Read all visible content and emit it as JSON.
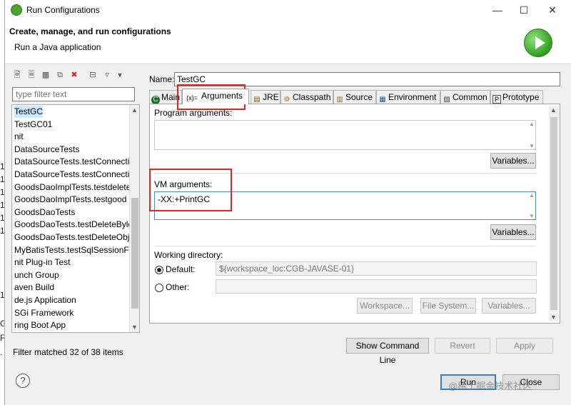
{
  "window": {
    "title": "Run Configurations",
    "banner_title": "Create, manage, and run configurations",
    "banner_subtitle": "Run a Java application"
  },
  "left": {
    "filter_placeholder": "type filter text",
    "items": [
      "TestGC",
      "TestGC01",
      "nit",
      "DataSourceTests",
      "DataSourceTests.testConnectic",
      "DataSourceTests.testConnectic",
      "GoodsDaoImplTests.testdelete",
      "GoodsDaoImplTests.testgood",
      "GoodsDaoTests",
      "GoodsDaoTests.testDeleteBylc",
      "GoodsDaoTests.testDeleteObj",
      "MyBatisTests.testSqlSessionFa",
      "nit Plug-in Test",
      "unch Group",
      "aven Build",
      "de.js Application",
      "SGi Framework",
      "ring Boot App"
    ],
    "cut_chars": [
      "1",
      "1",
      "1",
      "1",
      "1",
      "1",
      "1",
      "G",
      "F",
      "."
    ],
    "status": "Filter matched 32 of 38 items"
  },
  "right": {
    "name_label": "Name:",
    "name_value": "TestGC",
    "tabs": [
      {
        "label": "Main",
        "icon": "C"
      },
      {
        "label": "Arguments",
        "icon": "(x)="
      },
      {
        "label": "JRE",
        "icon": "▤"
      },
      {
        "label": "Classpath",
        "icon": "⚙"
      },
      {
        "label": "Source",
        "icon": "▥"
      },
      {
        "label": "Environment",
        "icon": "▦"
      },
      {
        "label": "Common",
        "icon": "▧"
      },
      {
        "label": "Prototype",
        "icon": "P"
      }
    ],
    "program_args_label": "Program arguments:",
    "program_args_value": "",
    "variables_label": "Variables...",
    "vm_args_label": "VM arguments:",
    "vm_args_value": "-XX:+PrintGC",
    "working_dir_label": "Working directory:",
    "default_label": "Default:",
    "default_value": "${workspace_loc:CGB-JAVASE-01}",
    "other_label": "Other:",
    "other_value": "",
    "workspace_btn": "Workspace...",
    "filesystem_btn": "File System...",
    "variables_btn3": "Variables..."
  },
  "buttons": {
    "show_command_line": "Show Command Line",
    "revert": "Revert",
    "apply": "Apply",
    "run": "Run",
    "close": "Close"
  },
  "watermark": "@稀土掘金技术社区",
  "colors": {
    "highlight": "#e02424",
    "run_green": "#3ea92d"
  }
}
